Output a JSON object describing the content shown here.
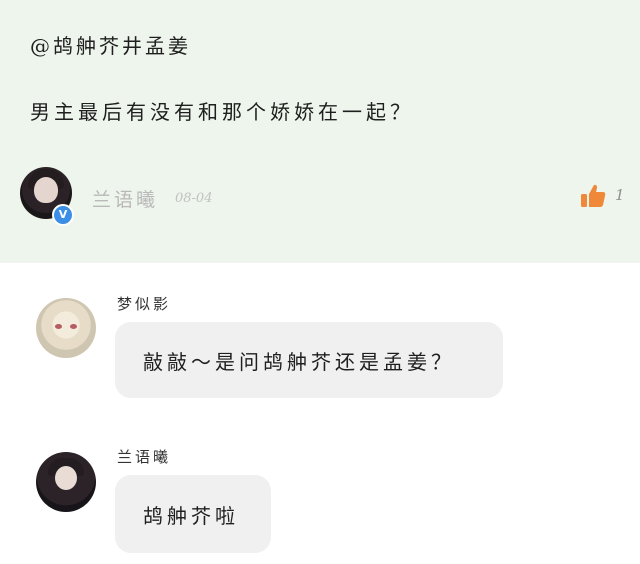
{
  "post": {
    "mention": "@鸪舯芥井孟姜",
    "question": "男主最后有没有和那个娇娇在一起？",
    "author": {
      "name": "兰语曦",
      "date": "08-04",
      "verified_icon": "verified-icon"
    },
    "likes": {
      "count": "1",
      "icon": "thumbs-up-icon",
      "color": "#f0883a"
    }
  },
  "replies": [
    {
      "name": "梦似影",
      "text": "敲敲～是问鸪舯芥还是孟姜？",
      "avatar": "anime-avatar"
    },
    {
      "name": "兰语曦",
      "text": "鸪舯芥啦",
      "avatar": "girl-avatar"
    }
  ],
  "colors": {
    "post_bg": "#eef5ec",
    "bubble_bg": "#f0f0f0",
    "verified": "#3b8ee6"
  }
}
